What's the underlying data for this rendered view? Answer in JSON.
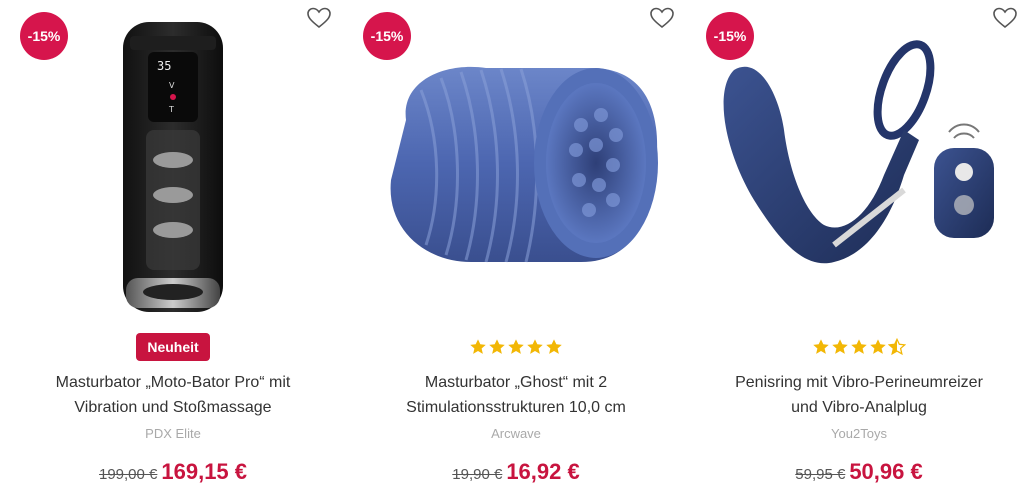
{
  "colors": {
    "accent": "#c8143f",
    "discount": "#d6154c",
    "star": "#f2b705",
    "text": "#333333",
    "brand": "#a9a9a9"
  },
  "products": [
    {
      "discount": "-15%",
      "badge": "Neuheit",
      "rating": null,
      "title_line1": "Masturbator „Moto-Bator Pro“ mit",
      "title_line2": "Vibration und Stoßmassage",
      "brand": "PDX Elite",
      "old_price": "199,00 €",
      "new_price": "169,15 €",
      "image": "black-masturbator-image"
    },
    {
      "discount": "-15%",
      "badge": null,
      "rating": 5,
      "title_line1": "Masturbator „Ghost“ mit 2",
      "title_line2": "Stimulationsstrukturen 10,0 cm",
      "brand": "Arcwave",
      "old_price": "19,90 €",
      "new_price": "16,92 €",
      "image": "blue-sleeve-image"
    },
    {
      "discount": "-15%",
      "badge": null,
      "rating": 4.5,
      "title_line1": "Penisring mit Vibro-Perineumreizer",
      "title_line2": "und Vibro-Analplug",
      "brand": "You2Toys",
      "old_price": "59,95 €",
      "new_price": "50,96 €",
      "image": "blue-ring-plug-image"
    }
  ]
}
